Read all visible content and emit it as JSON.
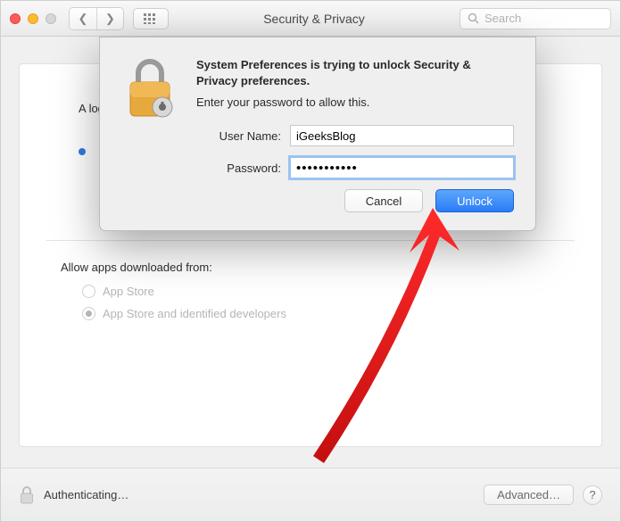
{
  "window": {
    "title": "Security & Privacy"
  },
  "search": {
    "placeholder": "Search"
  },
  "panel": {
    "login_prefix": "A log",
    "allow_title": "Allow apps downloaded from:",
    "opt_appstore": "App Store",
    "opt_identified": "App Store and identified developers"
  },
  "dialog": {
    "title": "System Preferences is trying to unlock Security & Privacy preferences.",
    "subtitle": "Enter your password to allow this.",
    "username_label": "User Name:",
    "password_label": "Password:",
    "username_value": "iGeeksBlog",
    "password_value": "•••••••••••",
    "cancel": "Cancel",
    "unlock": "Unlock"
  },
  "footer": {
    "status": "Authenticating…",
    "advanced": "Advanced…",
    "help": "?"
  }
}
